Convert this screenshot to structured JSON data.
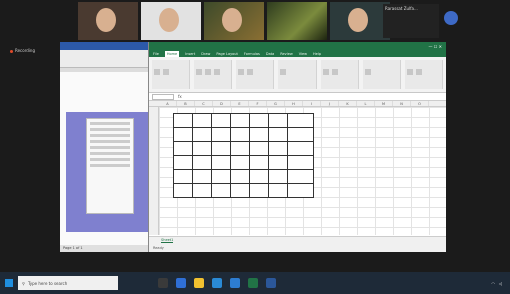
{
  "meeting": {
    "participants": [
      {
        "name": ""
      },
      {
        "name": ""
      },
      {
        "name": ""
      },
      {
        "name": ""
      },
      {
        "name": ""
      }
    ],
    "extra_participant": "Rarassat Zulfa...",
    "more_label": "",
    "side_label": "Recording"
  },
  "document": {
    "title": "",
    "footer": "Page 1 of 1"
  },
  "excel": {
    "title": "",
    "tabs": [
      "File",
      "Home",
      "Insert",
      "Draw",
      "Page Layout",
      "Formulas",
      "Data",
      "Review",
      "View",
      "Help"
    ],
    "active_tab": "Home",
    "namebox": "",
    "fx": "fx",
    "columns": [
      "A",
      "B",
      "C",
      "D",
      "E",
      "F",
      "G",
      "H",
      "I",
      "J",
      "K",
      "L",
      "M",
      "N",
      "O"
    ],
    "table": {
      "headers": [
        "",
        "",
        "",
        "",
        "",
        "",
        ""
      ],
      "rows": [
        [
          "",
          "",
          "",
          "",
          "",
          "",
          ""
        ],
        [
          "",
          "",
          "",
          "",
          "",
          "",
          ""
        ],
        [
          "",
          "",
          "",
          "",
          "",
          "",
          ""
        ],
        [
          "",
          "",
          "",
          "",
          "",
          "",
          ""
        ],
        [
          "",
          "",
          "",
          "",
          "",
          "",
          ""
        ]
      ]
    },
    "sheet_tab": "Sheet1",
    "status": "Ready"
  },
  "under_text": "",
  "taskbar": {
    "search_placeholder": "Type here to search",
    "tray_text": "",
    "time": "",
    "date": ""
  },
  "colors": {
    "excel_green": "#217346",
    "doc_purple": "#7f80cf",
    "taskbar": "#1e2a38"
  }
}
